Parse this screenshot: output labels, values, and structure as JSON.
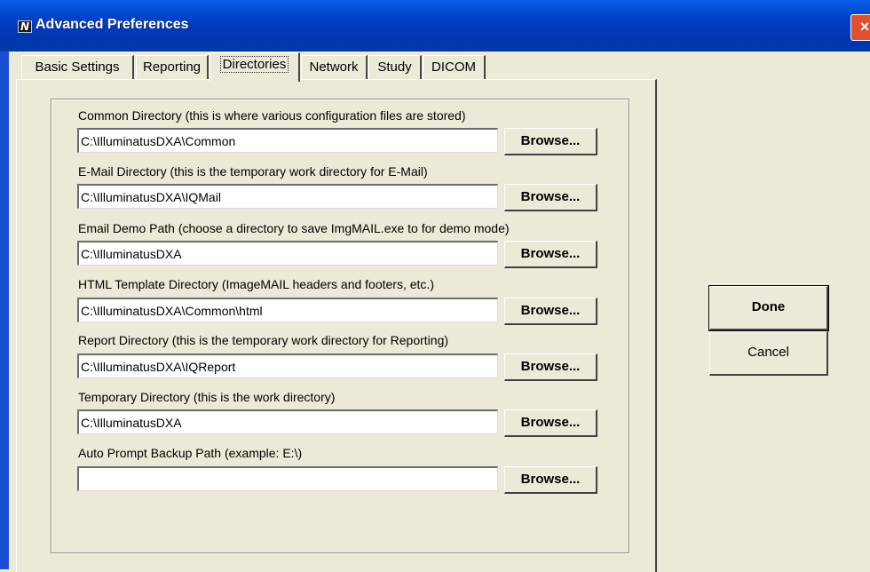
{
  "window": {
    "title": "Advanced Preferences",
    "icon_text": "N",
    "close_label": "×"
  },
  "tabs": [
    {
      "label": "Basic Settings",
      "active": false
    },
    {
      "label": "Reporting",
      "active": false
    },
    {
      "label": "Directories",
      "active": true
    },
    {
      "label": "Network",
      "active": false
    },
    {
      "label": "Study",
      "active": false
    },
    {
      "label": "DICOM",
      "active": false
    }
  ],
  "directories": [
    {
      "label": "Common Directory (this is where various configuration files are stored)",
      "value": "C:\\IlluminatusDXA\\Common",
      "button": "Browse..."
    },
    {
      "label": "E-Mail Directory (this is the temporary work directory for E-Mail)",
      "value": "C:\\IlluminatusDXA\\IQMail",
      "button": "Browse..."
    },
    {
      "label": "Email Demo Path (choose a directory to save ImgMAIL.exe to for demo mode)",
      "value": "C:\\IlluminatusDXA",
      "button": "Browse..."
    },
    {
      "label": "HTML Template Directory (ImageMAIL headers and footers, etc.)",
      "value": "C:\\IlluminatusDXA\\Common\\html",
      "button": "Browse..."
    },
    {
      "label": "Report Directory (this is the temporary work directory for Reporting)",
      "value": "C:\\IlluminatusDXA\\IQReport",
      "button": "Browse..."
    },
    {
      "label": "Temporary Directory (this is the work directory)",
      "value": "C:\\IlluminatusDXA",
      "button": "Browse..."
    },
    {
      "label": "Auto Prompt Backup Path (example: E:\\)",
      "value": "",
      "button": "Browse..."
    }
  ],
  "actions": {
    "done_label": "Done",
    "cancel_label": "Cancel"
  },
  "colors": {
    "titlebar": "#0042c8",
    "dialog_bg": "#ece9d8",
    "close_button": "#e0502e"
  }
}
